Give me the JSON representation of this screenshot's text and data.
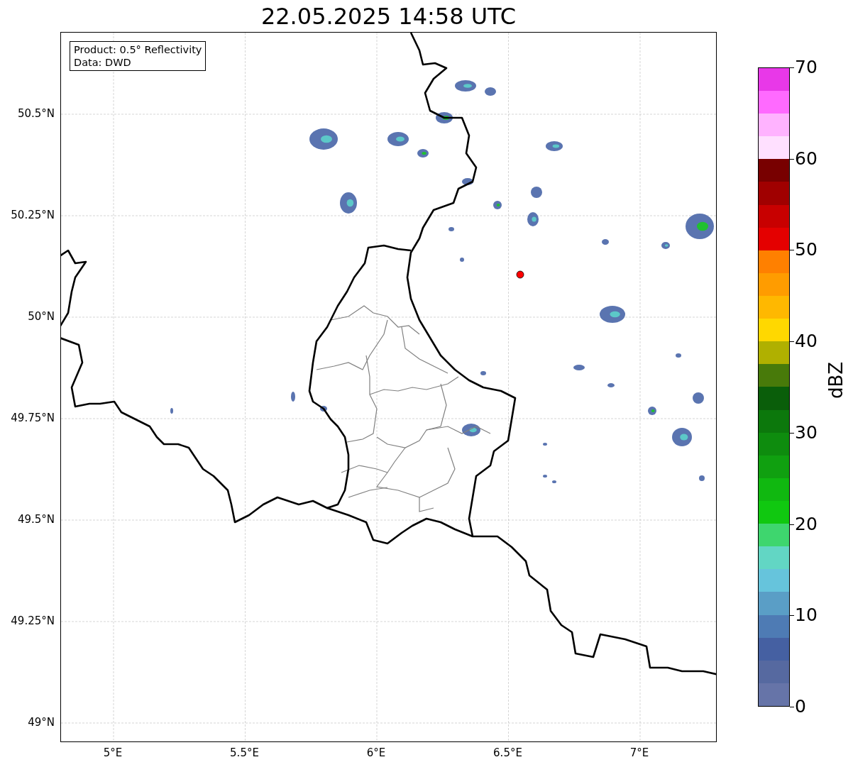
{
  "title": "22.05.2025 14:58 UTC",
  "info_box": {
    "lines": [
      "Product: 0.5° Reflectivity",
      "Data: DWD"
    ]
  },
  "map": {
    "lat_labels": [
      "50.5°N",
      "50.25°N",
      "50°N",
      "49.75°N",
      "49.5°N",
      "49.25°N",
      "49°N"
    ],
    "lon_labels": [
      "5°E",
      "5.5°E",
      "6°E",
      "6.5°E",
      "7°E"
    ]
  },
  "colorbar": {
    "label": "dBZ",
    "ticks": [
      "70",
      "60",
      "50",
      "40",
      "30",
      "20",
      "10",
      "0"
    ],
    "segments": [
      {
        "color": "#6674a8"
      },
      {
        "color": "#5669a0"
      },
      {
        "color": "#4560a2"
      },
      {
        "color": "#4e7bb4"
      },
      {
        "color": "#5a9ec6"
      },
      {
        "color": "#66c4dc"
      },
      {
        "color": "#62d6c4"
      },
      {
        "color": "#3ed66e"
      },
      {
        "color": "#10c810"
      },
      {
        "color": "#10b810"
      },
      {
        "color": "#10a010"
      },
      {
        "color": "#0e8c0e"
      },
      {
        "color": "#0c780c"
      },
      {
        "color": "#0a5e0a"
      },
      {
        "color": "#487a0a"
      },
      {
        "color": "#b0b000"
      },
      {
        "color": "#ffd800"
      },
      {
        "color": "#ffb800"
      },
      {
        "color": "#ff9c00"
      },
      {
        "color": "#ff8000"
      },
      {
        "color": "#e40000"
      },
      {
        "color": "#c80000"
      },
      {
        "color": "#a00000"
      },
      {
        "color": "#780000"
      },
      {
        "color": "#ffe0ff"
      },
      {
        "color": "#ffb3ff"
      },
      {
        "color": "#ff6aff"
      },
      {
        "color": "#e838e8"
      }
    ]
  }
}
